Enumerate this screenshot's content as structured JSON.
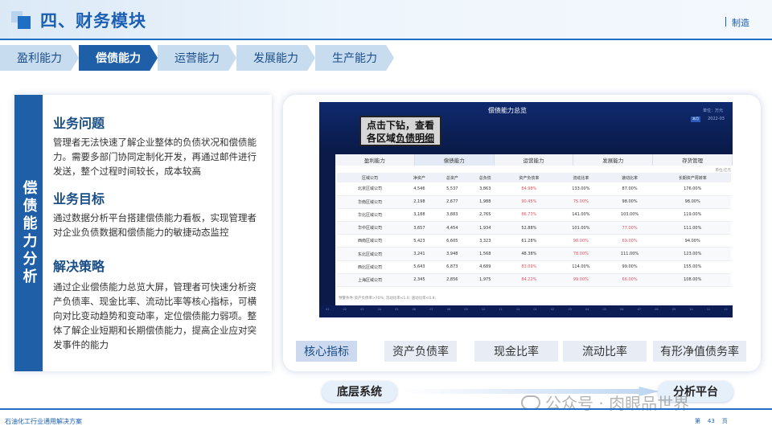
{
  "header": {
    "title": "四、财务模块",
    "right_tag": "制造"
  },
  "tabs": [
    {
      "label": "盈利能力",
      "active": false
    },
    {
      "label": "偿债能力",
      "active": true
    },
    {
      "label": "运营能力",
      "active": false
    },
    {
      "label": "发展能力",
      "active": false
    },
    {
      "label": "生产能力",
      "active": false
    }
  ],
  "left": {
    "side_label": "偿债能力分析",
    "sections": [
      {
        "title": "业务问题",
        "body": "管理者无法快速了解企业整体的负债状况和偿债能力。需要多部门协同定制化开发，再通过邮件进行发送，整个过程时间较长，成本较高"
      },
      {
        "title": "业务目标",
        "body": "通过数据分析平台搭建偿债能力看板，实现管理者对企业负债数据和偿债能力的敏捷动态监控"
      },
      {
        "title": "解决策略",
        "body": "通过企业偿债能力总览大屏，管理者可快速分析资产负债率、现金比率、流动比率等核心指标，可横向对比变动趋势和变动率，定位偿债能力弱项。整体了解企业短期和长期偿债能力，提高企业应对突发事件的能力"
      }
    ]
  },
  "dashboard": {
    "title": "偿债能力总览",
    "unit": "单位：万元",
    "date_box": "本月",
    "date": "2022-03",
    "callout_line1": "点击下钻，查看",
    "callout_line2_prefix": "各区域",
    "callout_line2_link": "负债明细",
    "inner_tabs": [
      "盈利能力",
      "偿债能力",
      "运营能力",
      "发展能力",
      "存货管理"
    ],
    "inner_unit": "单位:亿元",
    "columns": [
      "区域公司",
      "净资产",
      "总资产",
      "总负债",
      "资产负债率",
      "流动比率",
      "速动比率",
      "长期资产周转率"
    ],
    "rows": [
      [
        "北京区域公司",
        "4,546",
        "5,537",
        "3,863",
        "84.98%",
        "133.00%",
        "87.00%",
        "176.00%"
      ],
      [
        "华南区域公司",
        "2,198",
        "2,677",
        "1,988",
        "90.45%",
        "75.00%",
        "98.00%",
        "98.00%"
      ],
      [
        "华北区域公司",
        "3,188",
        "3,883",
        "2,765",
        "86.73%",
        "141.00%",
        "103.00%",
        "119.00%"
      ],
      [
        "华中区域公司",
        "3,657",
        "4,454",
        "1,934",
        "52.88%",
        "101.00%",
        "77.00%",
        "111.00%"
      ],
      [
        "西南区域公司",
        "5,423",
        "6,605",
        "3,323",
        "61.28%",
        "98.00%",
        "69.00%",
        "94.00%"
      ],
      [
        "东北区域公司",
        "3,241",
        "3,948",
        "1,568",
        "48.38%",
        "78.00%",
        "111.00%",
        "123.00%"
      ],
      [
        "西北区域公司",
        "5,643",
        "6,873",
        "4,689",
        "83.09%",
        "114.00%",
        "99.00%",
        "155.00%"
      ],
      [
        "上海区域公司",
        "2,345",
        "2,856",
        "1,975",
        "84.22%",
        "99.00%",
        "66.00%",
        "108.00%"
      ]
    ],
    "red_cells": [
      [
        0,
        4
      ],
      [
        1,
        4
      ],
      [
        1,
        5
      ],
      [
        2,
        4
      ],
      [
        3,
        6
      ],
      [
        4,
        5
      ],
      [
        4,
        6
      ],
      [
        5,
        5
      ],
      [
        6,
        4
      ],
      [
        7,
        4
      ],
      [
        7,
        5
      ],
      [
        7,
        6
      ]
    ],
    "note": "预警条件:资产负债率>70%; 流动比率<1.0; 速动比率<0.8;",
    "bottom_ticks": [
      "01",
      "02",
      "03",
      "04",
      "05",
      "06",
      "07",
      "08",
      "09",
      "10",
      "11",
      "12",
      "01",
      "02",
      "03",
      "04",
      "05",
      "06",
      "07",
      "08",
      "09",
      "10",
      "11",
      "12"
    ]
  },
  "chips": [
    {
      "label": "核心指标",
      "active": true
    },
    {
      "label": "资产负债率",
      "active": false
    },
    {
      "label": "现金比率",
      "active": false
    },
    {
      "label": "流动比率",
      "active": false
    },
    {
      "label": "有形净值债务率",
      "active": false
    }
  ],
  "bottom": {
    "base": "底层系统",
    "platform": "分析平台"
  },
  "watermark": "公众号 · 肉眼品世界",
  "footer": {
    "left": "石油化工行业通用解决方案",
    "page_prefix": "第",
    "page_num": "43",
    "page_suffix": "页"
  }
}
